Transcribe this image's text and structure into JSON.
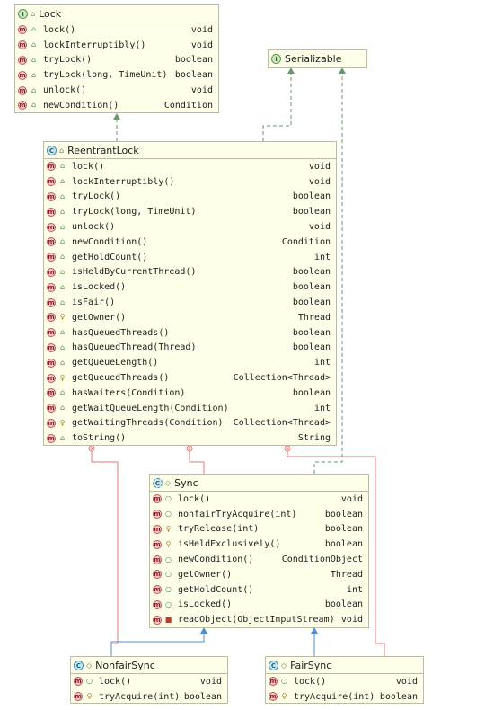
{
  "colors": {
    "implements": "#6a9a6a",
    "extends": "#4a8fd4",
    "inner": "#e07a7a",
    "box_fill": "#fefee9",
    "box_border": "#bcbca6"
  },
  "boxes": {
    "lock": {
      "title": "Lock",
      "kind": "interface",
      "members": [
        {
          "name": "lock()",
          "type": "void",
          "vis": "public"
        },
        {
          "name": "lockInterruptibly()",
          "type": "void",
          "vis": "public"
        },
        {
          "name": "tryLock()",
          "type": "boolean",
          "vis": "public"
        },
        {
          "name": "tryLock(long, TimeUnit)",
          "type": "boolean",
          "vis": "public"
        },
        {
          "name": "unlock()",
          "type": "void",
          "vis": "public"
        },
        {
          "name": "newCondition()",
          "type": "Condition",
          "vis": "public"
        }
      ]
    },
    "serializable": {
      "title": "Serializable",
      "kind": "interface",
      "members": []
    },
    "reentrant_lock": {
      "title": "ReentrantLock",
      "kind": "class",
      "members": [
        {
          "name": "lock()",
          "type": "void",
          "vis": "public"
        },
        {
          "name": "lockInterruptibly()",
          "type": "void",
          "vis": "public"
        },
        {
          "name": "tryLock()",
          "type": "boolean",
          "vis": "public"
        },
        {
          "name": "tryLock(long, TimeUnit)",
          "type": "boolean",
          "vis": "public"
        },
        {
          "name": "unlock()",
          "type": "void",
          "vis": "public"
        },
        {
          "name": "newCondition()",
          "type": "Condition",
          "vis": "public"
        },
        {
          "name": "getHoldCount()",
          "type": "int",
          "vis": "public"
        },
        {
          "name": "isHeldByCurrentThread()",
          "type": "boolean",
          "vis": "public"
        },
        {
          "name": "isLocked()",
          "type": "boolean",
          "vis": "public"
        },
        {
          "name": "isFair()",
          "type": "boolean",
          "vis": "public"
        },
        {
          "name": "getOwner()",
          "type": "Thread",
          "vis": "protected"
        },
        {
          "name": "hasQueuedThreads()",
          "type": "boolean",
          "vis": "public"
        },
        {
          "name": "hasQueuedThread(Thread)",
          "type": "boolean",
          "vis": "public"
        },
        {
          "name": "getQueueLength()",
          "type": "int",
          "vis": "public"
        },
        {
          "name": "getQueuedThreads()",
          "type": "Collection<Thread>",
          "vis": "protected"
        },
        {
          "name": "hasWaiters(Condition)",
          "type": "boolean",
          "vis": "public"
        },
        {
          "name": "getWaitQueueLength(Condition)",
          "type": "int",
          "vis": "public"
        },
        {
          "name": "getWaitingThreads(Condition)",
          "type": "Collection<Thread>",
          "vis": "protected"
        },
        {
          "name": "toString()",
          "type": "String",
          "vis": "public"
        }
      ]
    },
    "sync": {
      "title": "Sync",
      "kind": "abstract",
      "members": [
        {
          "name": "lock()",
          "type": "void",
          "vis": "package"
        },
        {
          "name": "nonfairTryAcquire(int)",
          "type": "boolean",
          "vis": "package"
        },
        {
          "name": "tryRelease(int)",
          "type": "boolean",
          "vis": "protected"
        },
        {
          "name": "isHeldExclusively()",
          "type": "boolean",
          "vis": "protected"
        },
        {
          "name": "newCondition()",
          "type": "ConditionObject",
          "vis": "package"
        },
        {
          "name": "getOwner()",
          "type": "Thread",
          "vis": "package"
        },
        {
          "name": "getHoldCount()",
          "type": "int",
          "vis": "package"
        },
        {
          "name": "isLocked()",
          "type": "boolean",
          "vis": "package"
        },
        {
          "name": "readObject(ObjectInputStream)",
          "type": "void",
          "vis": "private"
        }
      ]
    },
    "nonfair_sync": {
      "title": "NonfairSync",
      "kind": "class",
      "members": [
        {
          "name": "lock()",
          "type": "void",
          "vis": "package"
        },
        {
          "name": "tryAcquire(int)",
          "type": "boolean",
          "vis": "protected"
        }
      ]
    },
    "fair_sync": {
      "title": "FairSync",
      "kind": "class",
      "members": [
        {
          "name": "lock()",
          "type": "void",
          "vis": "package"
        },
        {
          "name": "tryAcquire(int)",
          "type": "boolean",
          "vis": "protected"
        }
      ]
    }
  }
}
